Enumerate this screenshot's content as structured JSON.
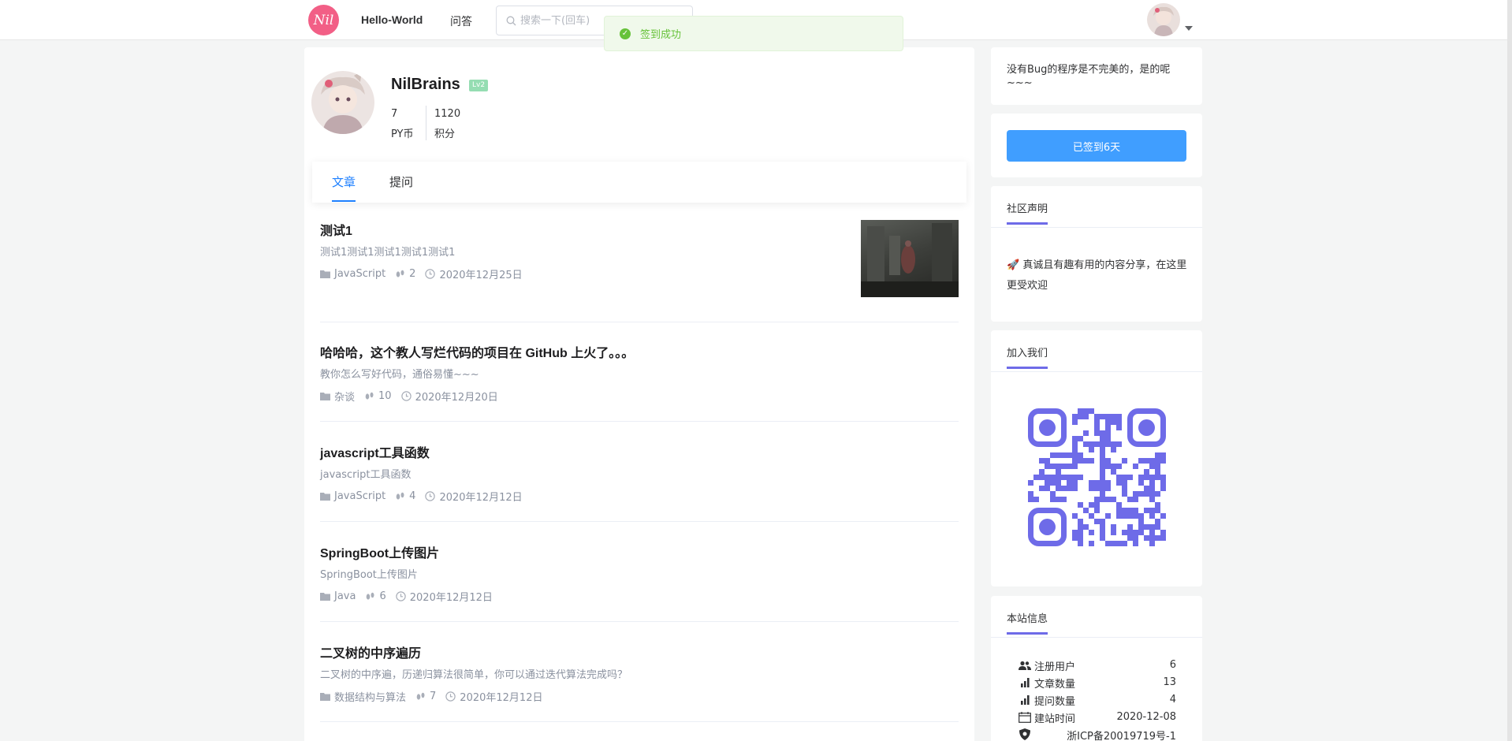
{
  "header": {
    "logo_text": "Nil",
    "nav": [
      "Hello-World",
      "问答"
    ],
    "search_placeholder": "搜索一下(回车)",
    "toast": "签到成功"
  },
  "profile": {
    "name": "NilBrains",
    "level": "Lv2",
    "stats": [
      {
        "value": "7",
        "label": "PY币"
      },
      {
        "value": "1120",
        "label": "积分"
      }
    ]
  },
  "tabs": [
    "文章",
    "提问"
  ],
  "articles": [
    {
      "title": "测试1",
      "desc": "测试1测试1测试1测试1测试1",
      "category": "JavaScript",
      "views": "2",
      "date": "2020年12月25日",
      "has_thumb": true
    },
    {
      "title": "哈哈哈，这个教人写烂代码的项目在 GitHub 上火了。。。",
      "desc": "教你怎么写好代码，通俗易懂~~~",
      "category": "杂谈",
      "views": "10",
      "date": "2020年12月20日"
    },
    {
      "title": "javascript工具函数",
      "desc": "javascript工具函数",
      "category": "JavaScript",
      "views": "4",
      "date": "2020年12月12日"
    },
    {
      "title": "SpringBoot上传图片",
      "desc": "SpringBoot上传图片",
      "category": "Java",
      "views": "6",
      "date": "2020年12月12日"
    },
    {
      "title": "二叉树的中序遍历",
      "desc": "二叉树的中序遍，历递归算法很简单，你可以通过迭代算法完成吗？",
      "category": "数据结构与算法",
      "views": "7",
      "date": "2020年12月12日"
    }
  ],
  "sidebar": {
    "slogan": "没有Bug的程序是不完美的，是的呢~~~",
    "signin_label": "已签到6天",
    "notice_title": "社区声明",
    "notice_text": "🚀 真诚且有趣有用的内容分享，在这里更受欢迎",
    "join_title": "加入我们",
    "info_title": "本站信息",
    "info": [
      {
        "label": "注册用户",
        "value": "6",
        "icon": "users-icon"
      },
      {
        "label": "文章数量",
        "value": "13",
        "icon": "bar-chart-icon"
      },
      {
        "label": "提问数量",
        "value": "4",
        "icon": "bar-chart-icon"
      },
      {
        "label": "建站时间",
        "value": "2020-12-08",
        "icon": "calendar-icon"
      },
      {
        "label": "浙ICP备20019719号-1",
        "value": "",
        "icon": "shield-icon"
      }
    ]
  },
  "colors": {
    "accent": "#1e80ff",
    "signin": "#409eff",
    "qr": "#6e6be8",
    "success": "#67c23a",
    "logo": "#f25f86"
  }
}
